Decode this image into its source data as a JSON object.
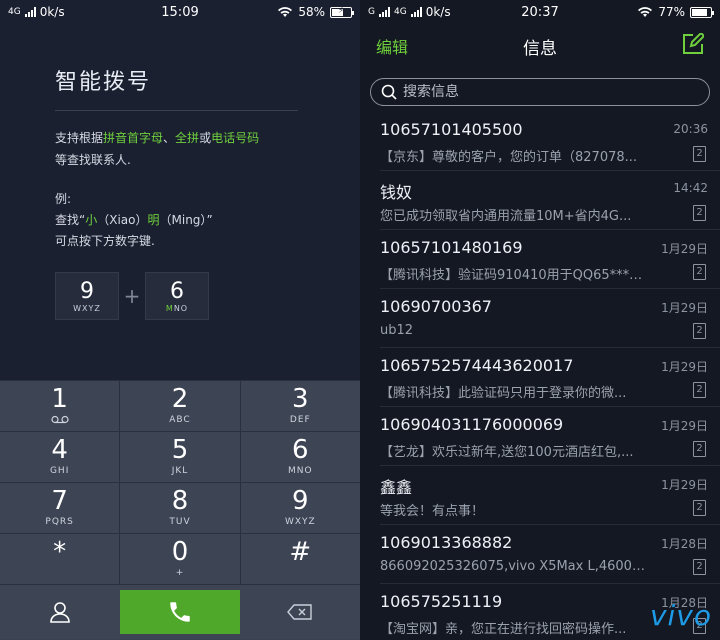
{
  "left_status": {
    "network": "4G",
    "speed": "0k/s",
    "time": "15:09",
    "battery": "58%"
  },
  "smart_dial": {
    "title": "智能拨号",
    "desc_1": "支持根据",
    "desc_pinyin": "拼音首字母",
    "desc_sep": "、",
    "desc_full": "全拼",
    "desc_or": "或",
    "desc_phone": "电话号码",
    "desc_2": "等查找联系人.",
    "example_label": "例:",
    "example_1": "查找“",
    "example_xiao": "小",
    "example_xiao_py": "（Xiao）",
    "example_ming": "明",
    "example_ming_py": "（Ming）",
    "example_end": "”",
    "example_2": "可点按下方数字键.",
    "demo_key_1": {
      "digit": "9",
      "letters_hl": "",
      "letters": "WXYZ"
    },
    "demo_plus": "+",
    "demo_key_2": {
      "digit": "6",
      "letters_hl": "M",
      "letters": "NO"
    }
  },
  "keypad": {
    "keys": [
      {
        "digit": "1",
        "letters": ""
      },
      {
        "digit": "2",
        "letters": "ABC"
      },
      {
        "digit": "3",
        "letters": "DEF"
      },
      {
        "digit": "4",
        "letters": "GHI"
      },
      {
        "digit": "5",
        "letters": "JKL"
      },
      {
        "digit": "6",
        "letters": "MNO"
      },
      {
        "digit": "7",
        "letters": "PQRS"
      },
      {
        "digit": "8",
        "letters": "TUV"
      },
      {
        "digit": "9",
        "letters": "WXYZ"
      },
      {
        "digit": "*",
        "letters": ""
      },
      {
        "digit": "0",
        "letters": "+"
      },
      {
        "digit": "#",
        "letters": ""
      }
    ]
  },
  "right_status": {
    "carrier": "G",
    "network": "4G",
    "speed": "0k/s",
    "time": "20:37",
    "battery": "77%"
  },
  "messages_app": {
    "edit_label": "编辑",
    "title": "信息",
    "search_placeholder": "搜索信息",
    "accent_color": "#6fcf3c",
    "threads": [
      {
        "sender": "10657101405500",
        "time": "20:36",
        "preview": "【京东】尊敬的客户，您的订单（827078...",
        "sim": "2"
      },
      {
        "sender": "钱奴",
        "time": "14:42",
        "preview": "您已成功领取省内通用流量10M+省内4G...",
        "sim": "2"
      },
      {
        "sender": "10657101480169",
        "time": "1月29日",
        "preview": "【腾讯科技】验证码910410用于QQ65****...",
        "sim": "2"
      },
      {
        "sender": "10690700367",
        "time": "1月29日",
        "preview": "ub12",
        "sim": "2"
      },
      {
        "sender": "1065752574443620017",
        "time": "1月29日",
        "preview": "【腾讯科技】此验证码只用于登录你的微...",
        "sim": "2"
      },
      {
        "sender": "106904031176000069",
        "time": "1月29日",
        "preview": "【艺龙】欢乐过新年,送您100元酒店红包,...",
        "sim": "2"
      },
      {
        "sender": "鑫鑫",
        "time": "1月29日",
        "preview": "等我会！有点事！",
        "sim": "2"
      },
      {
        "sender": "1069013368882",
        "time": "1月28日",
        "preview": "866092025326075,vivo X5Max L,46002,0,12,...",
        "sim": "2"
      },
      {
        "sender": "106575251119",
        "time": "1月28日",
        "preview": "【淘宝网】亲，您正在进行找回密码操作...",
        "sim": "2"
      }
    ]
  },
  "watermark": "vivo"
}
